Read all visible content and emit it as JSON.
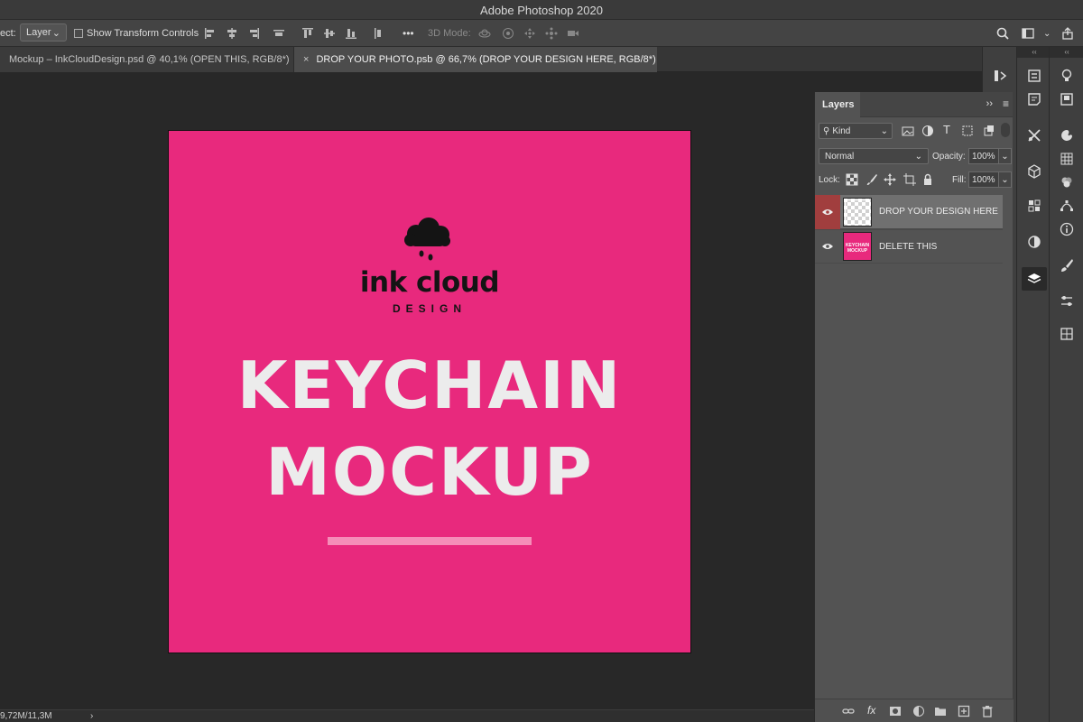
{
  "app": {
    "title": "Adobe Photoshop 2020"
  },
  "options_bar": {
    "select_label": "ect:",
    "select_value": "Layer",
    "show_transform_label": "Show Transform Controls",
    "more_label": "•••",
    "mode_3d_label": "3D Mode:"
  },
  "tabs": [
    {
      "label": "Mockup – InkCloudDesign.psd @ 40,1% (OPEN THIS, RGB/8*)",
      "active": false
    },
    {
      "label": "DROP YOUR PHOTO.psb @ 66,7% (DROP YOUR DESIGN HERE, RGB/8*)",
      "active": true,
      "close": "×"
    }
  ],
  "canvas": {
    "background_color": "#e8297d",
    "logo_main": "ink cloud",
    "logo_sub": "DESIGN",
    "headline_1": "KEYCHAIN",
    "headline_2": "MOCKUP",
    "underline_color": "#f58db8"
  },
  "status": {
    "doc_size": "9,72M/11,3M",
    "arrow": "›"
  },
  "layers_panel": {
    "title": "Layers",
    "filter_kind": "Kind",
    "blend_mode": "Normal",
    "opacity_label": "Opacity:",
    "opacity_value": "100%",
    "lock_label": "Lock:",
    "fill_label": "Fill:",
    "fill_value": "100%",
    "layers": [
      {
        "name": "DROP YOUR DESIGN HERE",
        "selected": true,
        "thumb": "transparent"
      },
      {
        "name": "DELETE THIS",
        "selected": false,
        "thumb": "keychain",
        "thumb_line_1": "KEYCHAIN",
        "thumb_line_2": "MOCKUP"
      }
    ],
    "footer_fx": "fx"
  },
  "colors": {
    "accent_selected_eye": "#a13e3e",
    "panel_bg": "#535353"
  }
}
